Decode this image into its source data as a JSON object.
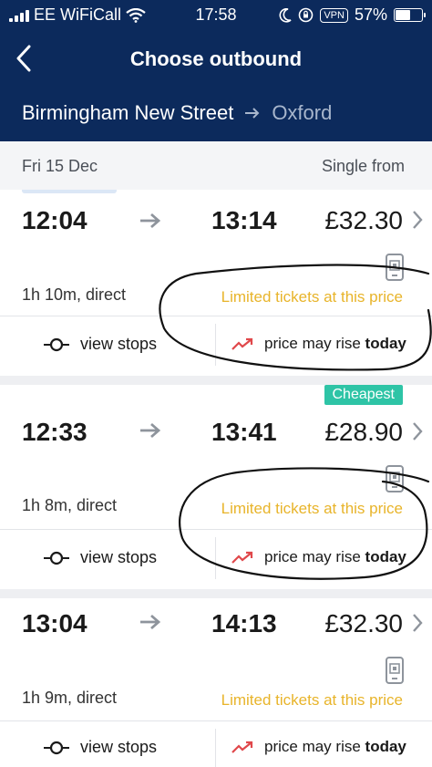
{
  "status": {
    "carrier": "EE WiFiCall",
    "time": "17:58",
    "vpn": "VPN",
    "battery": "57%",
    "battery_level": 0.57
  },
  "header": {
    "title": "Choose outbound",
    "origin": "Birmingham New Street",
    "destination": "Oxford"
  },
  "date_bar": {
    "date": "Fri 15 Dec",
    "fare_label": "Single from"
  },
  "journeys": [
    {
      "dep": "12:04",
      "arr": "13:14",
      "price": "£32.30",
      "duration": "1h 10m, direct",
      "notice": "Limited tickets at this price",
      "stops": "view stops",
      "rise_prefix": "price may rise ",
      "rise_bold": "today",
      "badge": ""
    },
    {
      "dep": "12:33",
      "arr": "13:41",
      "price": "£28.90",
      "duration": "1h 8m, direct",
      "notice": "Limited tickets at this price",
      "stops": "view stops",
      "rise_prefix": "price may rise ",
      "rise_bold": "today",
      "badge": "Cheapest"
    },
    {
      "dep": "13:04",
      "arr": "14:13",
      "price": "£32.30",
      "duration": "1h 9m, direct",
      "notice": "Limited tickets at this price",
      "stops": "view stops",
      "rise_prefix": "price may rise ",
      "rise_bold": "today",
      "badge": ""
    }
  ],
  "colors": {
    "header_bg": "#0c2a5c",
    "limited": "#e8b42a",
    "badge": "#2ec4a6",
    "rise_arrow": "#e0484b"
  },
  "icons": [
    "wifi-icon",
    "moon-icon",
    "rotation-lock-icon",
    "back-chevron-icon",
    "route-arrow-icon",
    "journey-arrow-icon",
    "chevron-right-icon",
    "mobile-ticket-icon",
    "stops-icon",
    "trending-up-icon"
  ]
}
